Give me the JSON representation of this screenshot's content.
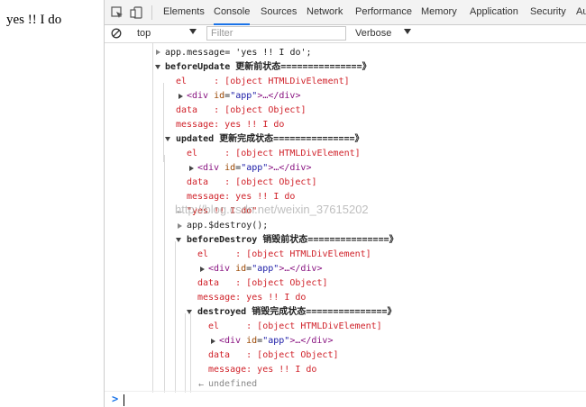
{
  "page": {
    "text": "yes !! I do"
  },
  "devtools": {
    "tabs": [
      "Elements",
      "Console",
      "Sources",
      "Network",
      "Performance",
      "Memory",
      "Application",
      "Security",
      "Au"
    ],
    "active_tab": "Console",
    "context": "top",
    "filter_placeholder": "Filter",
    "level": "Verbose"
  },
  "console": {
    "lines": [
      {
        "id": "l0",
        "text": "app.message= 'yes !! I do';"
      },
      {
        "id": "l1",
        "name": "beforeUpdate",
        "label": "更新前状态===============》"
      },
      {
        "id": "l2",
        "text": "el     : [object HTMLDivElement]"
      },
      {
        "id": "l3",
        "tag_open": "<div",
        "attr_name": "id",
        "attr_value": "\"app\"",
        "tag_rest": ">…</div>"
      },
      {
        "id": "l4",
        "text": "data   : [object Object]"
      },
      {
        "id": "l5",
        "text": "message: yes !! I do"
      },
      {
        "id": "l6",
        "name": "updated",
        "label": "更新完成状态===============》"
      },
      {
        "id": "l7",
        "text": "el     : [object HTMLDivElement]"
      },
      {
        "id": "l8",
        "tag_open": "<div",
        "attr_name": "id",
        "attr_value": "\"app\"",
        "tag_rest": ">…</div>"
      },
      {
        "id": "l9",
        "text": "data   : [object Object]"
      },
      {
        "id": "l10",
        "text": "message: yes !! I do"
      },
      {
        "id": "l11",
        "text": "\"yes !! I do\""
      },
      {
        "id": "l12",
        "text": "app.$destroy();"
      },
      {
        "id": "l13",
        "name": "beforeDestroy",
        "label": "销毁前状态===============》"
      },
      {
        "id": "l14",
        "text": "el     : [object HTMLDivElement]"
      },
      {
        "id": "l15",
        "tag_open": "<div",
        "attr_name": "id",
        "attr_value": "\"app\"",
        "tag_rest": ">…</div>"
      },
      {
        "id": "l16",
        "text": "data   : [object Object]"
      },
      {
        "id": "l17",
        "text": "message: yes !! I do"
      },
      {
        "id": "l18",
        "name": "destroyed",
        "label": "销毁完成状态===============》"
      },
      {
        "id": "l19",
        "text": "el     : [object HTMLDivElement]"
      },
      {
        "id": "l20",
        "tag_open": "<div",
        "attr_name": "id",
        "attr_value": "\"app\"",
        "tag_rest": ">…</div>"
      },
      {
        "id": "l21",
        "text": "data   : [object Object]"
      },
      {
        "id": "l22",
        "text": "message: yes !! I do"
      },
      {
        "id": "l23",
        "text": "undefined"
      }
    ],
    "prompt_symbol": ">",
    "watermark": "http://blog.csdn.net/weixin_37615202"
  },
  "colors": {
    "red": "#d0222a",
    "blue": "#1a1aa6",
    "active_tab_underline": "#1a73e8"
  }
}
